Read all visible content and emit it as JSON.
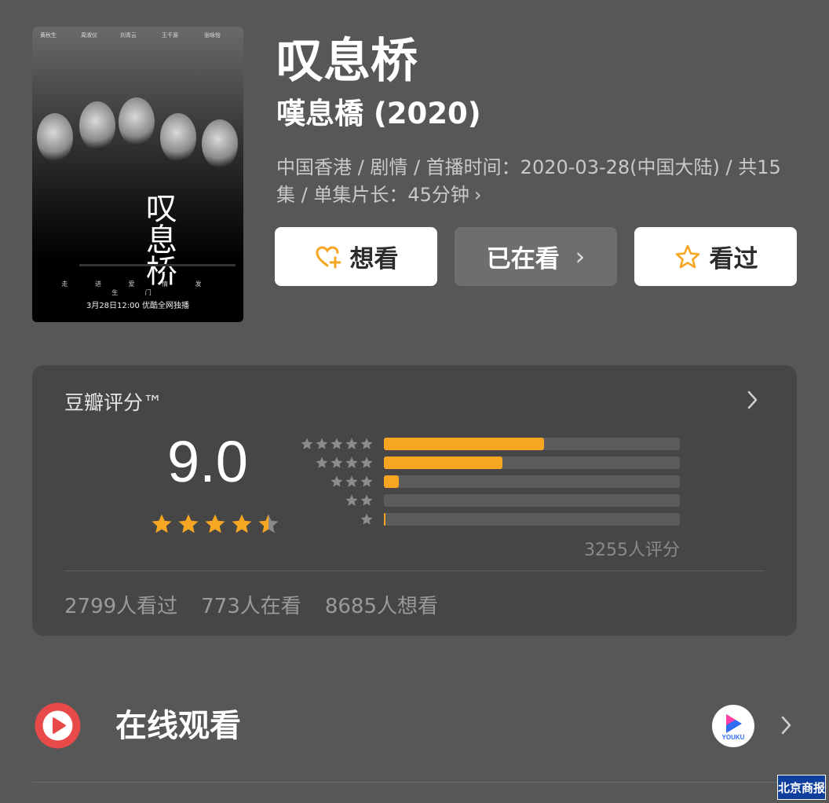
{
  "poster": {
    "cast": [
      "黄秋生",
      "周淑仪",
      "刘青云",
      "王千源",
      "张咏怡"
    ],
    "calligraphy": "叹息桥",
    "tagline": "走 进 爱 情 发 生 门",
    "airdate_text": "3月28日12:00 优酷全网独播"
  },
  "title": {
    "cn": "叹息桥",
    "original": "嘆息橋 (2020)"
  },
  "meta": {
    "line": "中国香港 / 剧情 / 首播时间：2020-03-28(中国大陆) / 共15集 / 单集片长：45分钟",
    "chevron": "›"
  },
  "actions": {
    "want_label": "想看",
    "watching_label": "已在看",
    "watching_chevron": "›",
    "watched_label": "看过"
  },
  "rating": {
    "title": "豆瓣评分™",
    "score": "9.0",
    "stars": 4.5,
    "distribution": [
      {
        "stars": 5,
        "fraction": 0.54
      },
      {
        "stars": 4,
        "fraction": 0.4
      },
      {
        "stars": 3,
        "fraction": 0.05
      },
      {
        "stars": 2,
        "fraction": 0.0
      },
      {
        "stars": 1,
        "fraction": 0.006
      }
    ],
    "count_text": "3255人评分",
    "stats": {
      "watched": "2799人看过",
      "watching": "773人在看",
      "want": "8685人想看"
    }
  },
  "online": {
    "label": "在线观看",
    "provider_logo_text": "YOUKU"
  },
  "watermark": "北京商报",
  "colors": {
    "background": "#575757",
    "card": "#464646",
    "accent_orange": "#f6a623",
    "bar_track": "#5c5c5c",
    "play_red": "#e84a4a"
  }
}
